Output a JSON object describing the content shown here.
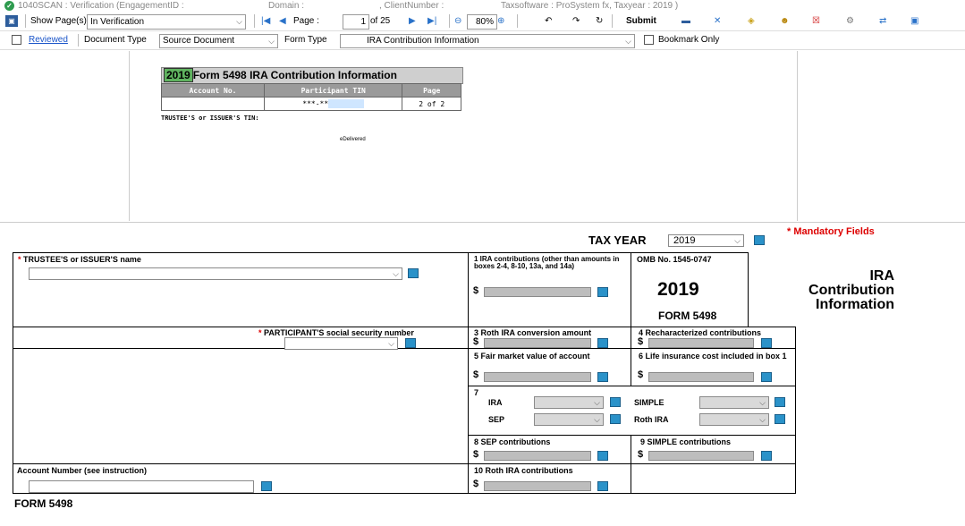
{
  "titlebar": {
    "app": "1040SCAN : Verification (EngagementID :",
    "domain": "Domain :",
    "client": ", ClientNumber :",
    "taxsoftware": "Taxsoftware : ProSystem fx, Taxyear : 2019 )"
  },
  "toolbar": {
    "show_pages_label": "Show Page(s)",
    "show_pages_value": "In Verification",
    "page_label": "Page :",
    "page_value": "1",
    "page_of": "of 25",
    "zoom": "80%",
    "submit_label": "Submit"
  },
  "row2": {
    "reviewed": "Reviewed",
    "doctype_label": "Document Type",
    "doctype_value": "Source Document",
    "formtype_label": "Form Type",
    "formtype_value": "IRA Contribution Information",
    "bookmark_label": "Bookmark Only"
  },
  "doc": {
    "year": "2019",
    "title": "Form 5498 IRA Contribution Information",
    "col_account": "Account No.",
    "col_tin": "Participant TIN",
    "col_page": "Page",
    "tin_value": "***-**",
    "page_value": "2 of 2",
    "trustee_tin": "TRUSTEE'S or ISSUER'S TIN:",
    "delivered": "eDelivered"
  },
  "form": {
    "tax_year_label": "TAX YEAR",
    "tax_year_value": "2019",
    "mandatory": "* Mandatory Fields",
    "trustee_label": "TRUSTEE'S or ISSUER'S name",
    "box1_label": "1 IRA contributions (other than amounts in boxes 2-4, 8-10, 13a, and 14a)",
    "omb": "OMB No. 1545-0747",
    "year_big": "2019",
    "form_label": "FORM 5498",
    "ira_line1": "IRA",
    "ira_line2": "Contribution",
    "ira_line3": "Information",
    "participant_label": "PARTICIPANT'S social security number",
    "box3_label": "3 Roth IRA conversion amount",
    "box4_label": "4 Recharacterized contributions",
    "box5_label": "5 Fair market value of account",
    "box6_label": "6 Life insurance cost included in box 1",
    "box7_label": "7",
    "box7_ira": "IRA",
    "box7_sep": "SEP",
    "box7_simple": "SIMPLE",
    "box7_roth": "Roth IRA",
    "box8_label": "8 SEP contributions",
    "box9_label": "9 SIMPLE contributions",
    "box10_label": "10 Roth IRA contributions",
    "account_label": "Account Number (see instruction)",
    "dollar": "$",
    "footer": "FORM 5498"
  }
}
